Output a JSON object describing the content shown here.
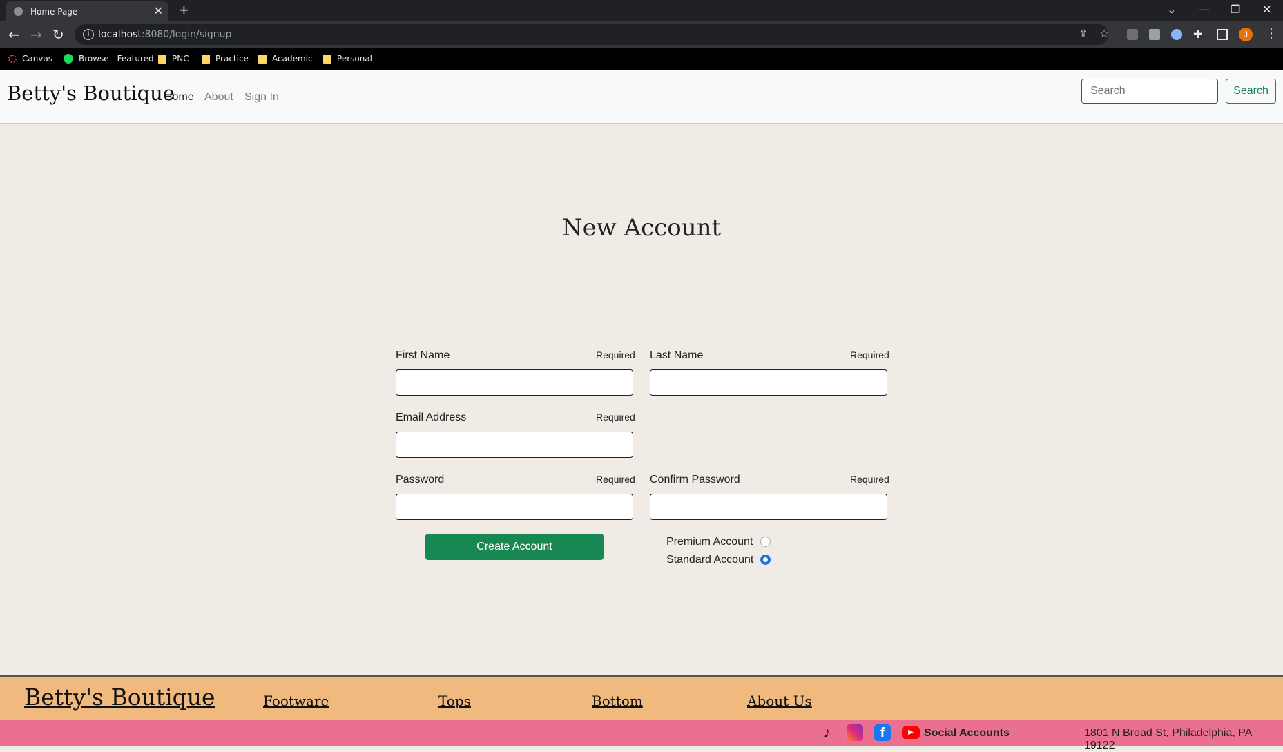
{
  "browser": {
    "tab_title": "Home Page",
    "url_host": "localhost",
    "url_rest": ":8080/login/signup",
    "bookmarks": [
      "Canvas",
      "Browse - Featured",
      "PNC",
      "Practice",
      "Academic",
      "Personal"
    ],
    "avatar_initial": "J"
  },
  "nav": {
    "brand": "Betty's Boutique",
    "links": [
      "Home",
      "About",
      "Sign In"
    ],
    "search_placeholder": "Search",
    "search_button": "Search"
  },
  "form": {
    "title": "New Account",
    "required": "Required",
    "first_name": "First Name",
    "last_name": "Last Name",
    "email": "Email Address",
    "password": "Password",
    "confirm_password": "Confirm Password",
    "create_button": "Create Account",
    "account_types": [
      {
        "label": "Premium Account",
        "checked": false
      },
      {
        "label": "Standard Account",
        "checked": true
      }
    ],
    "radio_color": "#1a73e8"
  },
  "footer": {
    "brand": "Betty's Boutique",
    "links": [
      "Footware",
      "Tops",
      "Bottom",
      "About Us"
    ],
    "social_label": "Social Accounts",
    "social_icons": [
      "tiktok-icon",
      "instagram-icon",
      "facebook-icon",
      "youtube-icon"
    ],
    "address": "1801 N Broad St, Philadelphia, PA 19122"
  },
  "colors": {
    "primary_green": "#198754",
    "footer_bg": "#f0b97e",
    "bottom_bar_bg": "#e9708f",
    "page_bg": "#f1ebe6"
  }
}
